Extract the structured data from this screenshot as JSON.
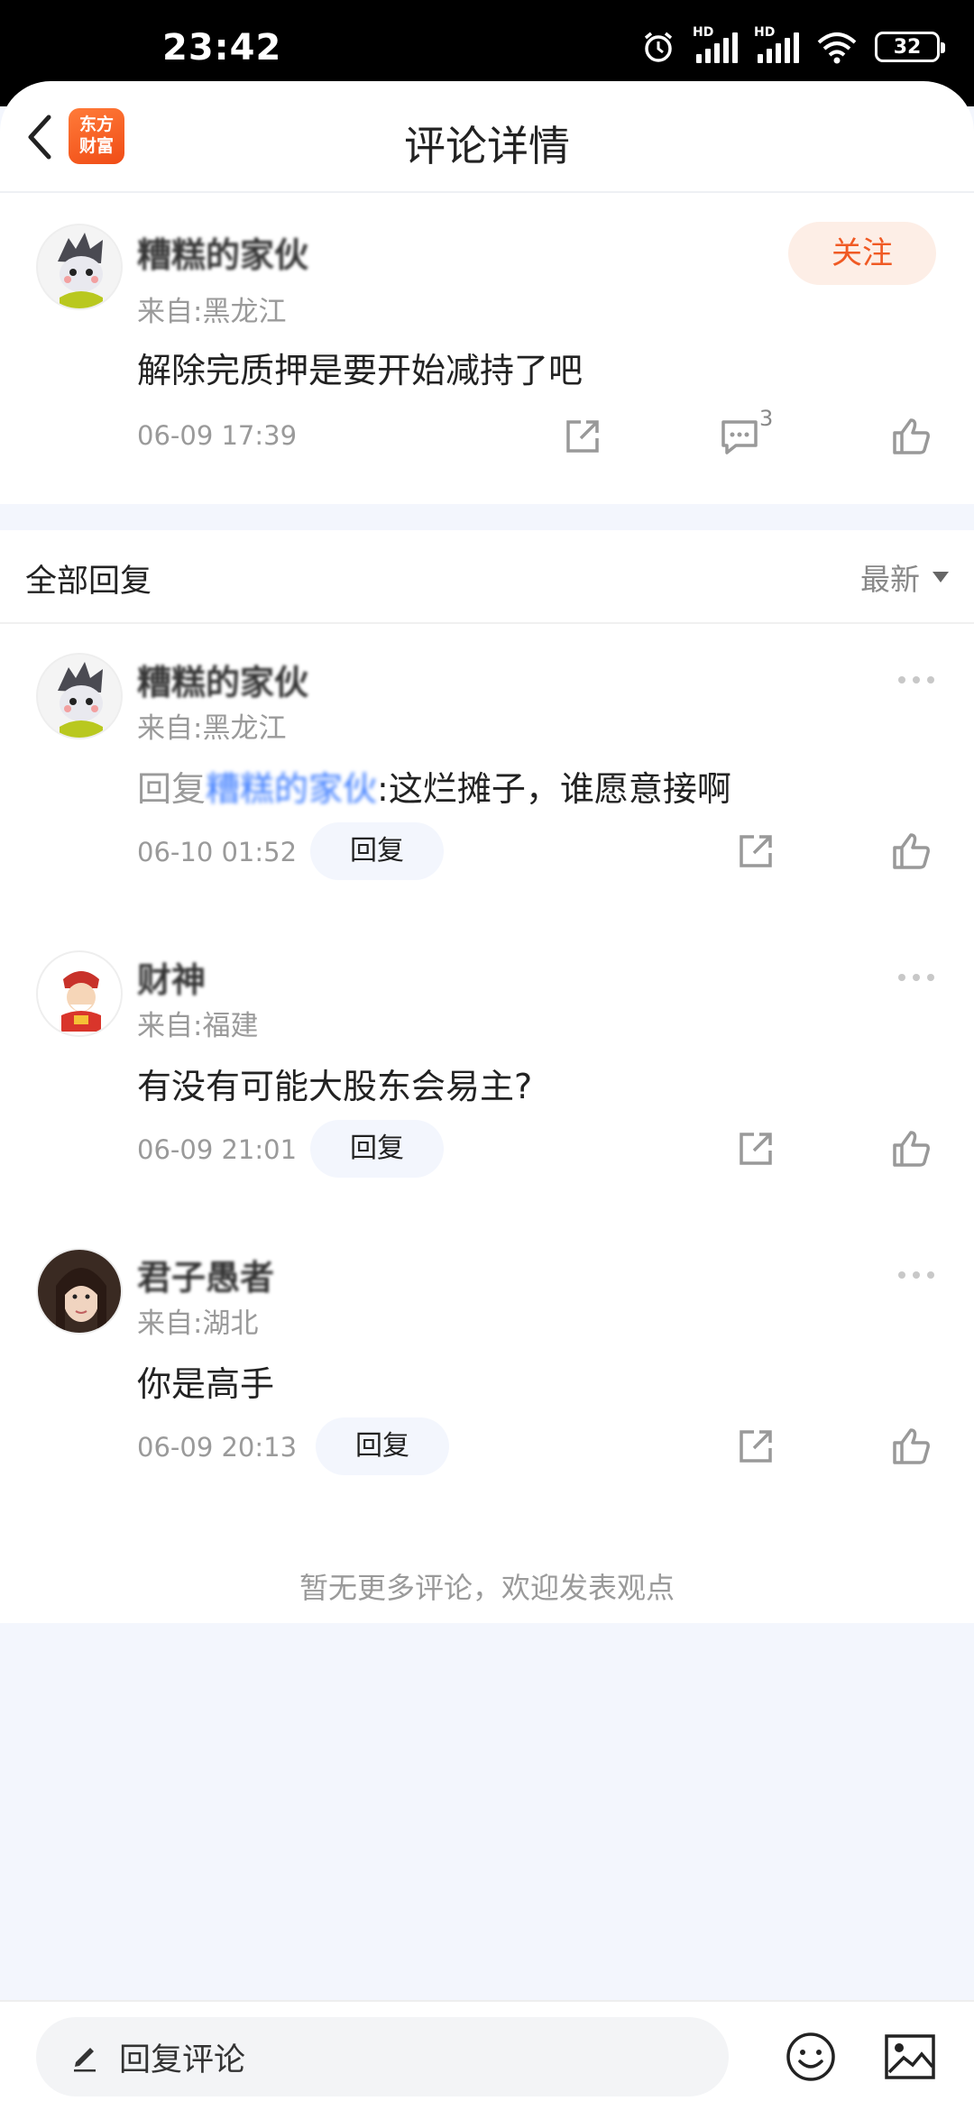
{
  "status": {
    "time": "23:42",
    "battery": "32",
    "hd1": "HD",
    "hd2": "HD"
  },
  "header": {
    "title": "评论详情",
    "logo_line1": "东方",
    "logo_line2": "财富"
  },
  "main_comment": {
    "username": "糟糕的家伙",
    "location": "来自:黑龙江",
    "content": "解除完质押是要开始减持了吧",
    "time": "06-09 17:39",
    "reply_count": "3",
    "follow_label": "关注"
  },
  "section": {
    "label": "全部回复",
    "sort": "最新"
  },
  "replies": [
    {
      "username": "糟糕的家伙",
      "location": "来自:黑龙江",
      "reply_prefix": "回复",
      "reply_to": "糟糕的家伙",
      "content": ":这烂摊子，谁愿意接啊",
      "time": "06-10 01:52",
      "reply_label": "回复"
    },
    {
      "username": "财神",
      "location": "来自:福建",
      "content": "有没有可能大股东会易主?",
      "time": "06-09 21:01",
      "reply_label": "回复"
    },
    {
      "username": "君子愚者",
      "location": "来自:湖北",
      "content": "你是高手",
      "time": "06-09 20:13",
      "reply_label": "回复"
    }
  ],
  "footer_note": "暂无更多评论，欢迎发表观点",
  "bottom": {
    "input_placeholder": "回复评论"
  },
  "colors": {
    "accent": "#f05a24",
    "follow_bg": "#fdeee6",
    "page_bg": "#f3f6fd"
  }
}
